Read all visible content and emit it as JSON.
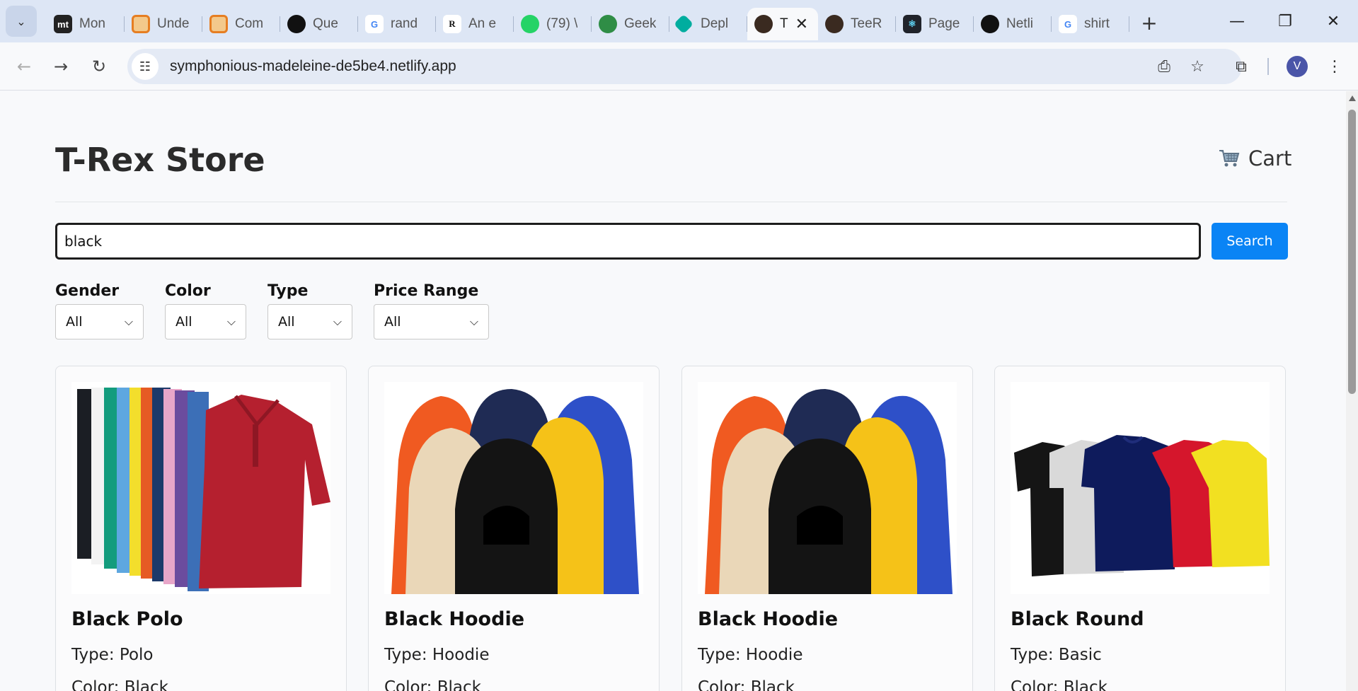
{
  "browser": {
    "tabs": [
      {
        "label": "Mon",
        "favicon": "mt",
        "favicon_bg": "#222222"
      },
      {
        "label": "Unde",
        "favicon": "",
        "favicon_bg": "#e67e22"
      },
      {
        "label": "Com",
        "favicon": "",
        "favicon_bg": "#e67e22"
      },
      {
        "label": "Que",
        "favicon": "",
        "favicon_bg": "#111111"
      },
      {
        "label": "rand",
        "favicon": "G",
        "favicon_bg": "#ffffff"
      },
      {
        "label": "An e",
        "favicon": "R",
        "favicon_bg": "#ffffff"
      },
      {
        "label": "(79) \\",
        "favicon": "",
        "favicon_bg": "#25d366"
      },
      {
        "label": "Geek",
        "favicon": "",
        "favicon_bg": "#2f8d46"
      },
      {
        "label": "Depl",
        "favicon": "",
        "favicon_bg": "#00ad9f"
      },
      {
        "label": "T",
        "favicon": "",
        "favicon_bg": "#3a2a20",
        "active": true
      },
      {
        "label": "TeeR",
        "favicon": "",
        "favicon_bg": "#3a2a20"
      },
      {
        "label": "Page",
        "favicon": "",
        "favicon_bg": "#20232a"
      },
      {
        "label": "Netli",
        "favicon": "",
        "favicon_bg": "#111111"
      },
      {
        "label": "shirt",
        "favicon": "G",
        "favicon_bg": "#ffffff"
      }
    ],
    "url": "symphonious-madeleine-de5be4.netlify.app",
    "profile_initial": "V"
  },
  "store": {
    "title": "T-Rex Store",
    "cart_label": "Cart",
    "search": {
      "value": "black",
      "button_label": "Search"
    }
  },
  "filters": [
    {
      "label": "Gender",
      "selected": "All"
    },
    {
      "label": "Color",
      "selected": "All"
    },
    {
      "label": "Type",
      "selected": "All"
    },
    {
      "label": "Price Range",
      "selected": "All"
    }
  ],
  "products": [
    {
      "name": "Black Polo",
      "type": "Type: Polo",
      "color": "Color: Black",
      "image": "polo-shirts-image"
    },
    {
      "name": "Black Hoodie",
      "type": "Type: Hoodie",
      "color": "Color: Black",
      "image": "hoodies-image"
    },
    {
      "name": "Black Hoodie",
      "type": "Type: Hoodie",
      "color": "Color: Black",
      "image": "hoodies-image"
    },
    {
      "name": "Black Round",
      "type": "Type: Basic",
      "color": "Color: Black",
      "image": "round-tshirts-image"
    }
  ],
  "colors": {
    "accent": "#0a84f5",
    "tabbar": "#dde6f5"
  }
}
